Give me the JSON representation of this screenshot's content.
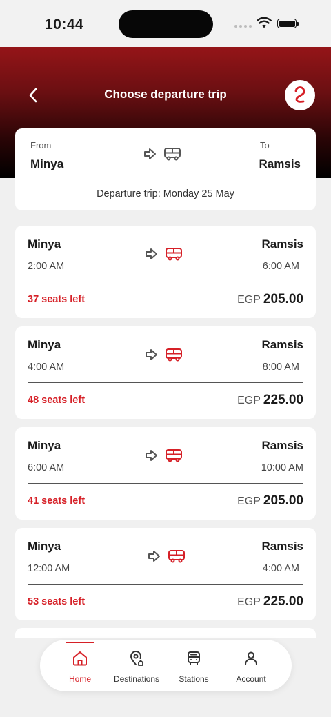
{
  "status_bar": {
    "time": "10:44"
  },
  "header": {
    "title": "Choose departure trip"
  },
  "summary": {
    "from_label": "From",
    "from_city": "Minya",
    "to_label": "To",
    "to_city": "Ramsis",
    "departure_text": "Departure trip: Monday 25 May"
  },
  "trips": [
    {
      "from": "Minya",
      "to": "Ramsis",
      "departure_time": "2:00 AM",
      "arrival_time": "6:00 AM",
      "seats_left": "37 seats left",
      "currency": "EGP",
      "price": "205.00"
    },
    {
      "from": "Minya",
      "to": "Ramsis",
      "departure_time": "4:00 AM",
      "arrival_time": "8:00 AM",
      "seats_left": "48 seats left",
      "currency": "EGP",
      "price": "225.00"
    },
    {
      "from": "Minya",
      "to": "Ramsis",
      "departure_time": "6:00 AM",
      "arrival_time": "10:00 AM",
      "seats_left": "41 seats left",
      "currency": "EGP",
      "price": "205.00"
    },
    {
      "from": "Minya",
      "to": "Ramsis",
      "departure_time": "12:00 AM",
      "arrival_time": "4:00 AM",
      "seats_left": "53 seats left",
      "currency": "EGP",
      "price": "225.00"
    }
  ],
  "tabs": [
    {
      "label": "Home",
      "icon": "home-icon",
      "active": true
    },
    {
      "label": "Destinations",
      "icon": "destinations-icon",
      "active": false
    },
    {
      "label": "Stations",
      "icon": "stations-icon",
      "active": false
    },
    {
      "label": "Account",
      "icon": "account-icon",
      "active": false
    }
  ],
  "colors": {
    "accent": "#d62027",
    "header_top": "#951518",
    "header_bottom": "#000000",
    "background": "#f0f0f0"
  }
}
